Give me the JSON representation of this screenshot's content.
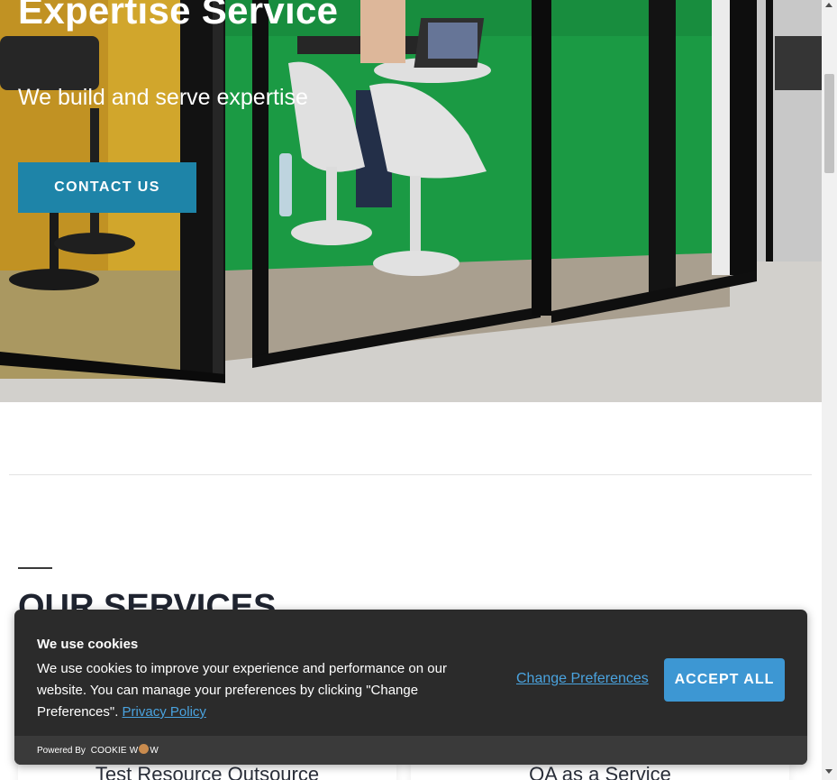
{
  "hero": {
    "title": "Expertise Service",
    "subtitle": "We build and serve expertise",
    "cta_label": "CONTACT US",
    "cta_color": "#1e84a8"
  },
  "services": {
    "title": "OUR SERVICES",
    "cards": [
      {
        "title": "Test Resource Outsource"
      },
      {
        "title": "QA as a Service"
      }
    ]
  },
  "cookie_banner": {
    "title": "We use cookies",
    "text": "We use cookies to improve your experience and performance on our website. You can manage your preferences by clicking \"Change Preferences\".",
    "privacy_link": "Privacy Policy",
    "change_preferences": "Change Preferences",
    "accept_all": "ACCEPT ALL",
    "powered_by": "Powered By",
    "brand": "COOKIE W",
    "brand_end": "W",
    "accent_color": "#3d97d3"
  }
}
